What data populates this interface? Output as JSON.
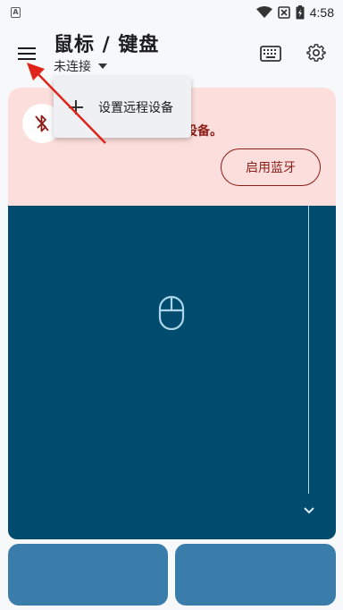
{
  "status_bar": {
    "left_badge": "A",
    "time": "4:58"
  },
  "app_bar": {
    "title": "鼠标 / 键盘",
    "subtitle": "未连接"
  },
  "banner": {
    "message": "设备。",
    "enable_button": "启用蓝牙"
  },
  "dropdown": {
    "item_label": "设置远程设备"
  },
  "colors": {
    "banner_bg": "#fcdedc",
    "banner_text": "#8c1d18",
    "touchpad": "#004b6e",
    "mouse_button": "#3a7daa",
    "annotation_arrow": "#e0241b"
  }
}
